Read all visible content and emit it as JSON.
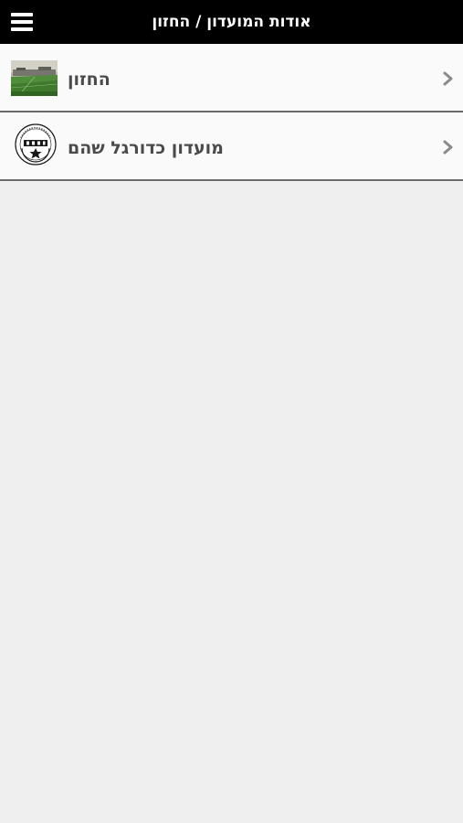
{
  "header": {
    "title": "אודות המועדון / החזון",
    "menu_icon": "hamburger-menu-icon"
  },
  "list": {
    "items": [
      {
        "label": "החזון",
        "thumbnail": "stadium-photo",
        "chevron": "chevron-right-icon"
      },
      {
        "label": "מועדון כדורגל שהם",
        "thumbnail": "club-crest-logo",
        "chevron": "chevron-right-icon"
      }
    ]
  },
  "colors": {
    "header_bg": "#000000",
    "page_bg": "#efefef",
    "row_bg": "#fafafa",
    "row_text": "#4a4a4a",
    "divider": "#6b6b6b"
  }
}
